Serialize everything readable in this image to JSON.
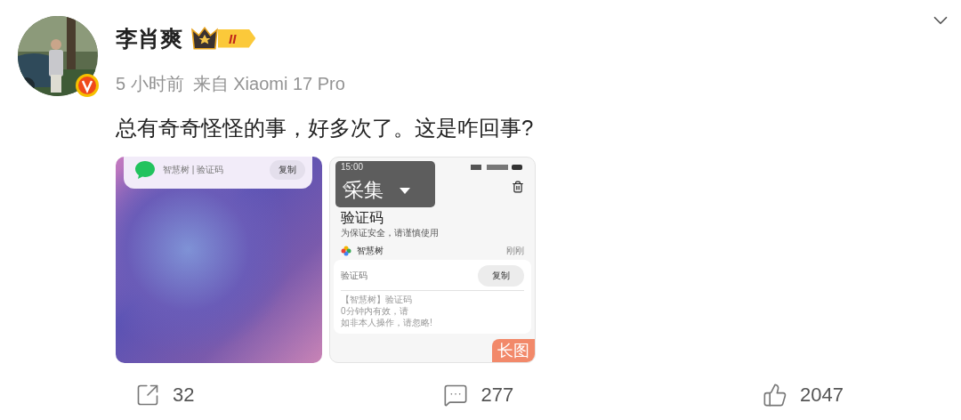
{
  "author": {
    "name": "李肖爽",
    "level_badge": "II",
    "verified": true
  },
  "meta": {
    "time": "5 小时前",
    "source": "来自 Xiaomi 17 Pro"
  },
  "text": "总有奇奇怪怪的事，好多次了。这是咋回事?",
  "images": [
    {
      "kind": "notification",
      "subtitle": "智慧树 | 验证码",
      "button": "复制"
    },
    {
      "kind": "phone_screen",
      "overlay": "采集",
      "clock": "15:00",
      "title": "验证码",
      "subtitle": "为保证安全，请谨慎使用",
      "sender": "智慧树",
      "time": "刚刚",
      "code_label": "验证码",
      "button": "复制",
      "message_lines": [
        "【智慧树】验证码",
        "0分钟内有效，请",
        "如非本人操作，请忽略!"
      ],
      "badge": "长图"
    }
  ],
  "actions": [
    {
      "kind": "share",
      "count": "32"
    },
    {
      "kind": "comment",
      "count": "277"
    },
    {
      "kind": "like",
      "count": "2047"
    }
  ]
}
